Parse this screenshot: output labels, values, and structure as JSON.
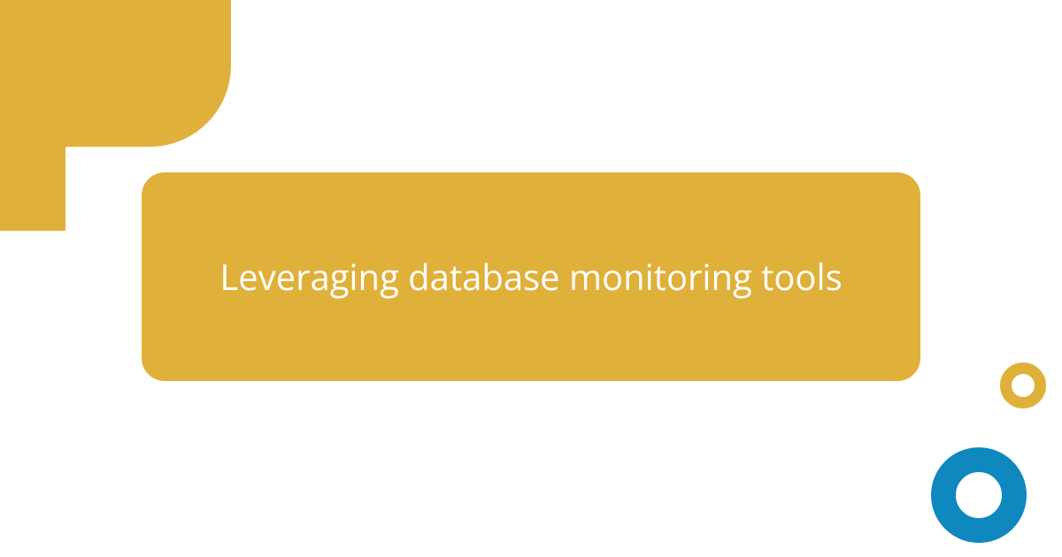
{
  "title": "Leveraging database monitoring tools",
  "colors": {
    "gold": "#dfb03a",
    "blue": "#0e88bf",
    "white": "#ffffff"
  }
}
